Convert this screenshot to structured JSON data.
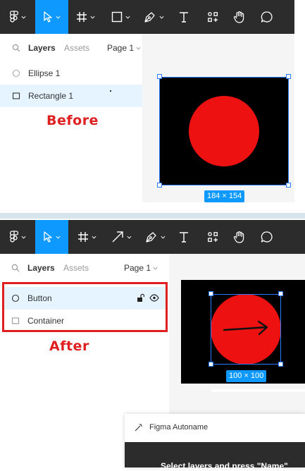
{
  "before": {
    "toolbar": {
      "tools": [
        {
          "name": "main-menu",
          "icon": "figma-logo-icon",
          "active": false
        },
        {
          "name": "move",
          "icon": "move-cursor-icon",
          "active": true
        },
        {
          "name": "frame",
          "icon": "frame-hash-icon",
          "active": false
        },
        {
          "name": "rectangle",
          "icon": "rectangle-icon",
          "active": false
        },
        {
          "name": "pen",
          "icon": "pen-icon",
          "active": false
        },
        {
          "name": "text",
          "icon": "text-icon",
          "active": false
        },
        {
          "name": "resources",
          "icon": "resources-icon",
          "active": false
        },
        {
          "name": "hand",
          "icon": "hand-icon",
          "active": false
        },
        {
          "name": "comment",
          "icon": "comment-icon",
          "active": false
        }
      ]
    },
    "tabs": {
      "layers": "Layers",
      "assets": "Assets",
      "page": "Page 1"
    },
    "layers": [
      {
        "label": "Ellipse 1",
        "icon": "ellipse-icon",
        "selected": false
      },
      {
        "label": "Rectangle 1",
        "icon": "rectangle-icon",
        "selected": true
      }
    ],
    "size_label": "184 × 154",
    "note": "Before"
  },
  "after": {
    "toolbar": {
      "tools": [
        {
          "name": "main-menu",
          "icon": "figma-logo-icon",
          "active": false
        },
        {
          "name": "move",
          "icon": "move-cursor-icon",
          "active": true
        },
        {
          "name": "frame",
          "icon": "frame-hash-icon",
          "active": false
        },
        {
          "name": "arrow",
          "icon": "arrow-icon",
          "active": false
        },
        {
          "name": "pen",
          "icon": "pen-icon",
          "active": false
        },
        {
          "name": "text",
          "icon": "text-icon",
          "active": false
        },
        {
          "name": "resources",
          "icon": "resources-icon",
          "active": false
        },
        {
          "name": "hand",
          "icon": "hand-icon",
          "active": false
        },
        {
          "name": "comment",
          "icon": "comment-icon",
          "active": false
        }
      ]
    },
    "tabs": {
      "layers": "Layers",
      "assets": "Assets",
      "page": "Page 1"
    },
    "layers": [
      {
        "label": "Button",
        "icon": "ellipse-icon",
        "selected": true,
        "locked": false,
        "visible": true
      },
      {
        "label": "Container",
        "icon": "rectangle-icon",
        "selected": false
      }
    ],
    "size_label": "100 × 100",
    "note": "After"
  },
  "plugin": {
    "title": "Figma Autoname",
    "instruction": "Select layers and press \"Name\""
  },
  "colors": {
    "toolbar_bg": "#2c2c2c",
    "accent": "#0d99ff",
    "selection": "#2a7cff",
    "shape_red": "#ee1111",
    "annotation_red": "#e02020"
  }
}
